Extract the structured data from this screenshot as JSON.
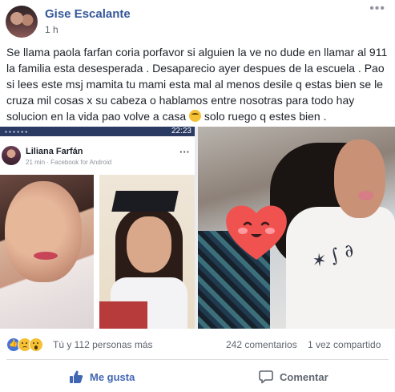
{
  "post": {
    "author": "Gise Escalante",
    "time": "1 h",
    "more_icon": "ellipsis-icon",
    "text": "Se llama paola farfan coria porfavor si alguien la ve no dude en llamar al 911 la familia esta desesperada . Desaparecio ayer despues de la escuela . Pao si lees este msj mamita tu mami esta mal al menos desile q estas bien se le cruza mil cosas x su cabeza o hablamos entre nosotras para todo hay solucion en la vida pao volve a casa",
    "text_emoji": "sad-face-emoji",
    "text_tail": " solo ruego q estes bien ."
  },
  "embedded_screenshot": {
    "clock": "22:23",
    "author": "Liliana Farfán",
    "meta": "21 min · Facebook for Android"
  },
  "stats": {
    "reaction_icons": [
      "like-icon",
      "sad-icon",
      "wow-icon"
    ],
    "reactions_text": "Tú y 112 personas más",
    "comments": "242 comentarios",
    "shares": "1 vez compartido"
  },
  "actions": {
    "like_label": "Me gusta",
    "comment_label": "Comentar"
  },
  "colors": {
    "link_blue": "#365899",
    "like_blue": "#4267b2",
    "meta_gray": "#616770",
    "heart_red": "#f0524f"
  }
}
